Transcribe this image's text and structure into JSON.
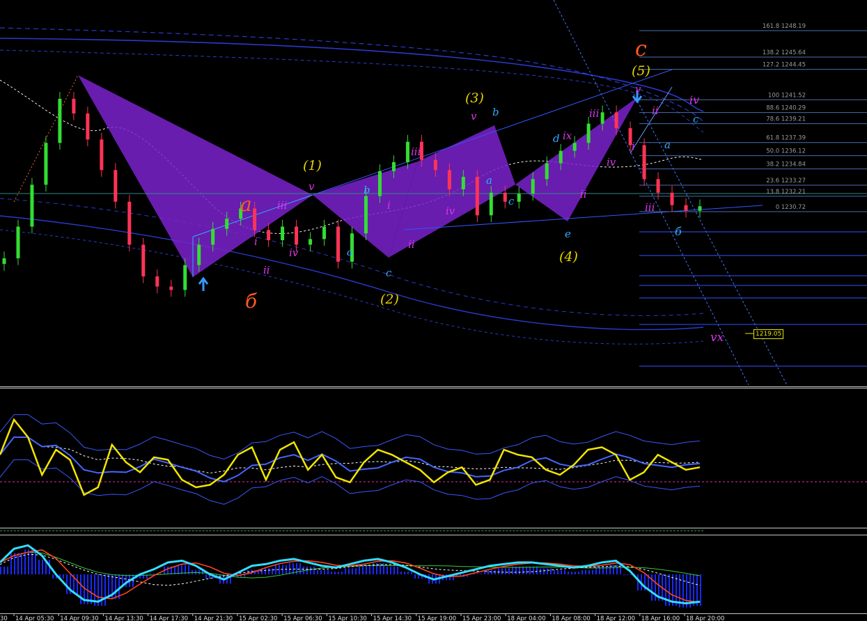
{
  "fib_levels": [
    {
      "label": "161.8 1248.19",
      "price": 1248.19
    },
    {
      "label": "138.2 1245.64",
      "price": 1245.64
    },
    {
      "label": "127.2 1244.45",
      "price": 1244.45
    },
    {
      "label": "100 1241.52",
      "price": 1241.52
    },
    {
      "label": "88.6 1240.29",
      "price": 1240.29
    },
    {
      "label": "78.6 1239.21",
      "price": 1239.21
    },
    {
      "label": "61.8 1237.39",
      "price": 1237.39
    },
    {
      "label": "50.0 1236.12",
      "price": 1236.12
    },
    {
      "label": "38.2 1234.84",
      "price": 1234.84
    },
    {
      "label": "23.6 1233.27",
      "price": 1233.27
    },
    {
      "label": "13.8 1232.21",
      "price": 1232.21
    },
    {
      "label": "0 1230.72",
      "price": 1230.72
    }
  ],
  "price_label": "1219.05",
  "wave_labels": {
    "a_big": "a",
    "b_big": "б",
    "c_big": "c",
    "w1": "(1)",
    "w2": "(2)",
    "w3": "(3)",
    "w4": "(4)",
    "w5": "(5)",
    "iii_1": "iii",
    "iv_1": "iv",
    "ii_1": "ii",
    "v_1": "v",
    "i_1": "i",
    "a_1": "a",
    "b_1": "b",
    "c_1": "c",
    "iii_2": "iii",
    "iv_2": "iv",
    "ii_2": "ii",
    "i_2": "i",
    "v_2": "v",
    "a_2": "a",
    "b_2": "b",
    "c_2": "c",
    "d_2": "d",
    "e_2": "e",
    "ix": "ix",
    "iii_3": "iii",
    "iv_3": "iv",
    "ii_3": "ii",
    "i_3": "i",
    "v_3": "v",
    "ii_4": "ii",
    "iv_4": "iv",
    "iii_4": "iii",
    "a_4": "a",
    "b_4": "б",
    "c_4": "c",
    "vx": "vx"
  },
  "time_axis": [
    "14 Apr 05:30",
    "14 Apr 09:30",
    "14 Apr 13:30",
    "14 Apr 17:30",
    "14 Apr 21:30",
    "15 Apr 02:30",
    "15 Apr 06:30",
    "15 Apr 10:30",
    "15 Apr 14:30",
    "15 Apr 19:00",
    "15 Apr 23:00",
    "18 Apr 04:00",
    "18 Apr 08:00",
    "18 Apr 12:00",
    "18 Apr 16:00",
    "18 Apr 20:00"
  ],
  "time_axis_left_stub": "30",
  "colors": {
    "background": "#000000",
    "bull": "#33dd33",
    "bear": "#ff3355",
    "pattern": "#7a22cc",
    "fib": "#6699cc",
    "wave_yellow": "#e6d200",
    "wave_orange": "#ff5a1e",
    "wave_magenta": "#dd33ee",
    "wave_cyan": "#33aaff",
    "osc_yellow": "#f2e600",
    "osc_cyan": "#33ddff",
    "hist": "#1a2aff"
  },
  "chart_data": {
    "type": "line",
    "title": "",
    "series": [
      {
        "values": [
          1228.4,
          1231.2,
          1234.9,
          1238.6,
          1242.5,
          1241.2,
          1238.9,
          1236.2,
          1233.4,
          1229.6,
          1226.8,
          1225.9,
          1225.6,
          1227.8,
          1229.6,
          1231.0,
          1231.9,
          1232.8,
          1230.9,
          1230.0,
          1231.2,
          1229.6,
          1230.1,
          1231.2,
          1228.1,
          1230.6,
          1233.9,
          1236.1,
          1236.9,
          1238.7,
          1237.1,
          1236.2,
          1234.5,
          1235.6,
          1232.2,
          1234.2,
          1233.4,
          1234.1,
          1235.4,
          1236.8,
          1237.9,
          1238.6,
          1240.3,
          1241.3,
          1239.9,
          1238.4,
          1235.4,
          1234.2,
          1233.1,
          1232.6,
          1233.0
        ]
      },
      {
        "values": [
          58,
          72,
          65,
          50,
          60,
          56,
          42,
          45,
          62,
          55,
          51,
          57,
          56,
          48,
          45,
          46,
          50,
          58,
          61,
          48,
          60,
          63,
          52,
          58,
          49,
          47,
          55,
          60,
          58,
          55,
          52,
          47,
          51,
          53,
          46,
          48,
          60,
          58,
          57,
          52,
          50,
          54,
          60,
          61,
          58,
          48,
          51,
          58,
          55,
          52,
          53
        ]
      },
      {
        "values": [
          62,
          70,
          72,
          66,
          55,
          46,
          40,
          39,
          43,
          50,
          55,
          58,
          62,
          63,
          60,
          55,
          52,
          56,
          60,
          61,
          63,
          64,
          62,
          60,
          59,
          61,
          63,
          64,
          62,
          59,
          55,
          52,
          54,
          56,
          58,
          60,
          61,
          62,
          62,
          61,
          60,
          59,
          60,
          62,
          63,
          57,
          48,
          42,
          39,
          38,
          39
        ]
      }
    ],
    "ylim": [
      1218,
      1250
    ]
  }
}
